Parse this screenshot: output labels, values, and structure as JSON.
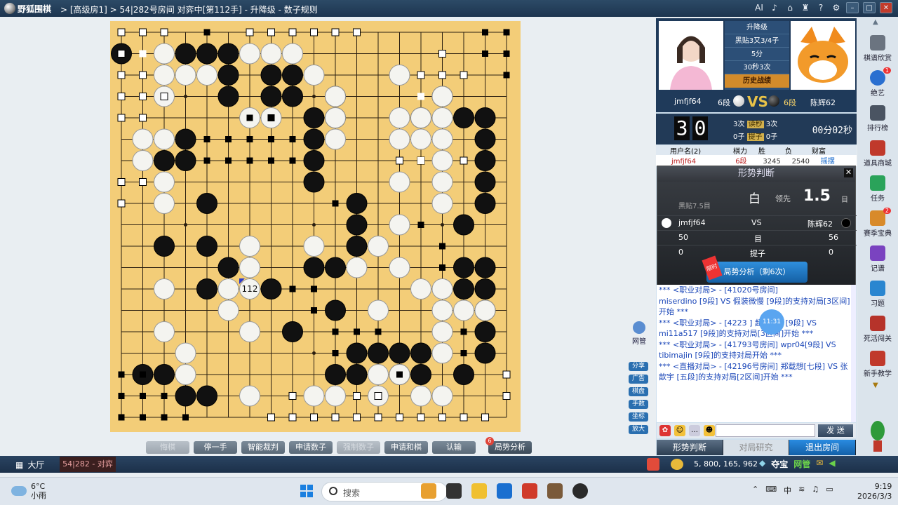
{
  "titlebar": {
    "app_name": "野狐围棋",
    "crumb": "> [高级房1] > 54|282号房间 对弈中[第112手] - 升降级 - 数子规则",
    "ai": "AI"
  },
  "board": {
    "size": 19,
    "last_move_number": "112",
    "last_move": [
      6,
      12
    ],
    "black": [
      [
        3,
        1
      ],
      [
        4,
        1
      ],
      [
        5,
        1
      ],
      [
        7,
        3
      ],
      [
        8,
        3
      ],
      [
        5,
        2
      ],
      [
        5,
        3
      ],
      [
        7,
        2
      ],
      [
        8,
        2
      ],
      [
        10,
        4
      ],
      [
        10,
        3
      ],
      [
        9,
        4
      ],
      [
        9,
        5
      ],
      [
        9,
        6
      ],
      [
        9,
        7
      ],
      [
        15,
        3
      ],
      [
        16,
        4
      ],
      [
        17,
        4
      ],
      [
        17,
        5
      ],
      [
        17,
        6
      ],
      [
        17,
        7
      ],
      [
        17,
        8
      ],
      [
        16,
        9
      ],
      [
        14,
        4
      ],
      [
        3,
        5
      ],
      [
        2,
        6
      ],
      [
        3,
        6
      ],
      [
        4,
        8
      ],
      [
        2,
        10
      ],
      [
        4,
        10
      ],
      [
        11,
        8
      ],
      [
        11,
        9
      ],
      [
        11,
        10
      ],
      [
        10,
        11
      ],
      [
        9,
        11
      ],
      [
        5,
        11
      ],
      [
        4,
        12
      ],
      [
        7,
        12
      ],
      [
        10,
        13
      ],
      [
        8,
        14
      ],
      [
        11,
        15
      ],
      [
        12,
        15
      ],
      [
        13,
        15
      ],
      [
        14,
        15
      ],
      [
        16,
        11
      ],
      [
        16,
        12
      ],
      [
        17,
        11
      ],
      [
        17,
        12
      ],
      [
        17,
        13
      ],
      [
        17,
        14
      ],
      [
        17,
        15
      ],
      [
        16,
        16
      ],
      [
        14,
        16
      ],
      [
        13,
        16
      ],
      [
        11,
        16
      ],
      [
        10,
        16
      ],
      [
        1,
        16
      ],
      [
        2,
        16
      ],
      [
        3,
        17
      ],
      [
        4,
        17
      ],
      [
        0,
        1
      ]
    ],
    "white": [
      [
        2,
        1
      ],
      [
        6,
        1
      ],
      [
        7,
        1
      ],
      [
        8,
        1
      ],
      [
        2,
        2
      ],
      [
        3,
        2
      ],
      [
        4,
        2
      ],
      [
        9,
        2
      ],
      [
        13,
        2
      ],
      [
        2,
        3
      ],
      [
        10,
        3
      ],
      [
        7,
        4
      ],
      [
        10,
        4
      ],
      [
        13,
        4
      ],
      [
        14,
        4
      ],
      [
        15,
        4
      ],
      [
        1,
        5
      ],
      [
        2,
        5
      ],
      [
        10,
        5
      ],
      [
        13,
        5
      ],
      [
        15,
        5
      ],
      [
        1,
        6
      ],
      [
        15,
        6
      ],
      [
        13,
        7
      ],
      [
        15,
        7
      ],
      [
        2,
        7
      ],
      [
        2,
        8
      ],
      [
        15,
        8
      ],
      [
        13,
        9
      ],
      [
        12,
        10
      ],
      [
        6,
        10
      ],
      [
        9,
        10
      ],
      [
        6,
        11
      ],
      [
        11,
        11
      ],
      [
        13,
        11
      ],
      [
        5,
        12
      ],
      [
        2,
        12
      ],
      [
        14,
        12
      ],
      [
        15,
        12
      ],
      [
        5,
        13
      ],
      [
        12,
        13
      ],
      [
        15,
        13
      ],
      [
        16,
        13
      ],
      [
        17,
        13
      ],
      [
        2,
        14
      ],
      [
        6,
        14
      ],
      [
        15,
        14
      ],
      [
        3,
        16
      ],
      [
        15,
        15
      ],
      [
        12,
        16
      ],
      [
        13,
        16
      ],
      [
        6,
        17
      ],
      [
        9,
        17
      ],
      [
        10,
        17
      ],
      [
        12,
        17
      ],
      [
        14,
        17
      ],
      [
        15,
        17
      ],
      [
        3,
        15
      ],
      [
        6,
        4
      ],
      [
        15,
        3
      ],
      [
        14,
        5
      ]
    ],
    "black_squares": [
      [
        4,
        0
      ],
      [
        17,
        0
      ],
      [
        18,
        0
      ],
      [
        17,
        1
      ],
      [
        18,
        1
      ],
      [
        18,
        2
      ],
      [
        0,
        17
      ],
      [
        0,
        18
      ],
      [
        1,
        18
      ],
      [
        2,
        18
      ],
      [
        3,
        18
      ],
      [
        1,
        17
      ],
      [
        2,
        17
      ],
      [
        1,
        16
      ],
      [
        0,
        16
      ],
      [
        6,
        4
      ],
      [
        7,
        5
      ],
      [
        8,
        5
      ],
      [
        6,
        5
      ],
      [
        5,
        5
      ],
      [
        4,
        5
      ],
      [
        5,
        6
      ],
      [
        4,
        6
      ],
      [
        6,
        6
      ],
      [
        8,
        6
      ],
      [
        7,
        6
      ],
      [
        10,
        8
      ],
      [
        15,
        10
      ],
      [
        15,
        11
      ],
      [
        14,
        9
      ],
      [
        8,
        12
      ],
      [
        9,
        12
      ],
      [
        9,
        13
      ],
      [
        10,
        14
      ],
      [
        11,
        14
      ],
      [
        12,
        14
      ],
      [
        16,
        14
      ],
      [
        16,
        15
      ],
      [
        13,
        16
      ],
      [
        10,
        15
      ]
    ],
    "white_squares": [
      [
        0,
        0
      ],
      [
        1,
        0
      ],
      [
        2,
        0
      ],
      [
        6,
        0
      ],
      [
        7,
        0
      ],
      [
        8,
        0
      ],
      [
        9,
        0
      ],
      [
        10,
        0
      ],
      [
        11,
        0
      ],
      [
        0,
        1
      ],
      [
        0,
        2
      ],
      [
        1,
        2
      ],
      [
        0,
        3
      ],
      [
        1,
        3
      ],
      [
        2,
        3
      ],
      [
        0,
        4
      ],
      [
        1,
        4
      ],
      [
        0,
        7
      ],
      [
        1,
        7
      ],
      [
        0,
        8
      ],
      [
        14,
        2
      ],
      [
        15,
        2
      ],
      [
        15,
        1
      ],
      [
        16,
        2
      ],
      [
        16,
        6
      ],
      [
        13,
        6
      ],
      [
        14,
        6
      ],
      [
        12,
        17
      ],
      [
        11,
        17
      ],
      [
        8,
        17
      ],
      [
        9,
        18
      ],
      [
        10,
        18
      ],
      [
        11,
        18
      ],
      [
        12,
        18
      ],
      [
        13,
        18
      ],
      [
        14,
        18
      ],
      [
        15,
        18
      ],
      [
        16,
        18
      ],
      [
        17,
        18
      ],
      [
        18,
        17
      ],
      [
        18,
        16
      ],
      [
        8,
        18
      ],
      [
        7,
        18
      ]
    ],
    "marked_white": [
      [
        1,
        1
      ],
      [
        14,
        3
      ],
      [
        14,
        6
      ]
    ],
    "marked_black": [
      [
        7,
        4
      ]
    ]
  },
  "players": {
    "mode": "升降级",
    "rule": "黑贴3又3/4子",
    "main_time": "5分",
    "byoyomi": "30秒3次",
    "history": "历史战绩",
    "white_name": "jmfjf64",
    "white_rank": "6段",
    "vs": "VS",
    "black_rank": "6段",
    "black_name": "陈辉62"
  },
  "clock": {
    "d1": "3",
    "d2": "0",
    "row1_l": "3次",
    "row1_tag": "读秒",
    "row1_r": "3次",
    "row2_l": "0子",
    "row2_tag": "提子",
    "row2_r": "0子",
    "time": "00分02秒"
  },
  "userlist": {
    "h_name": "用户名(2)",
    "h_power": "棋力",
    "h_win": "胜",
    "h_loss": "负",
    "h_wealth": "财富",
    "r_name": "jmfjf64",
    "r_power": "6段",
    "r_win": "3245",
    "r_loss": "2540",
    "r_wealth": "摇摆"
  },
  "situation": {
    "title": "形势判断",
    "close": "✕",
    "leader": "白",
    "lead_label": "领先",
    "lead_value": "1.5",
    "lead_unit": "目",
    "komi": "黑贴7.5目",
    "white_name": "jmfjf64",
    "vs": "VS",
    "black_name": "陈辉62",
    "white_points": "50",
    "points_label": "目",
    "black_points": "56",
    "white_captures": "0",
    "captures_label": "提子",
    "black_captures": "0",
    "analyze_label": "局势分析（剩6次）",
    "new_badge": "限时"
  },
  "chat": {
    "lines": [
      "*** <职业对局> - [41020号房间]",
      "miserdino [9段] VS 假装微慢 [9段]的支持对局[3区间]开始 ***",
      "*** <职业对局> - [4223 ]  超哥哥1 [9段] VS mi11a517 [9段]的支持对局[3区间]开始 ***",
      "*** <职业对局> - [41793号房间] wpr04[9段] VS tibimajin [9段]的支持对局开始 ***",
      "*** <直播对局> - [42196号房间] 郑载想[七段] VS 张歆宇 [五段]的支持对局[2区间]开始 ***"
    ],
    "bubble_time": "11:31",
    "send_label": "发 送"
  },
  "bottom_tabs": {
    "t1": "形势判断",
    "t2": "对局研究",
    "t3": "退出房间"
  },
  "sidebar": {
    "items": [
      "棋谱欣赏",
      "绝艺",
      "排行榜",
      "道具商城",
      "任务",
      "赛季宝典",
      "记谱",
      "习题",
      "死活闯关",
      "新手教学"
    ],
    "badge_juey": "1",
    "badge_season": "2"
  },
  "float_tools": [
    "分享",
    "广告",
    "棋盘",
    "手数",
    "坐标",
    "放大"
  ],
  "net_admin": "网管",
  "actions": [
    "悔棋",
    "停一手",
    "智能裁判",
    "申请数子",
    "强制数子",
    "申请和棋",
    "认输",
    "局势分析"
  ],
  "actions_badge": "6",
  "statusbar": {
    "lobby": "大厅",
    "room": "54|282 - 对弈",
    "money": "5, 800, 165, 962",
    "duobao": "夺宝",
    "wangguan": "网管"
  },
  "taskbar": {
    "temp": "6°C",
    "weather": "小雨",
    "search": "搜索",
    "time": "9:19",
    "date": "2026/3/3"
  }
}
